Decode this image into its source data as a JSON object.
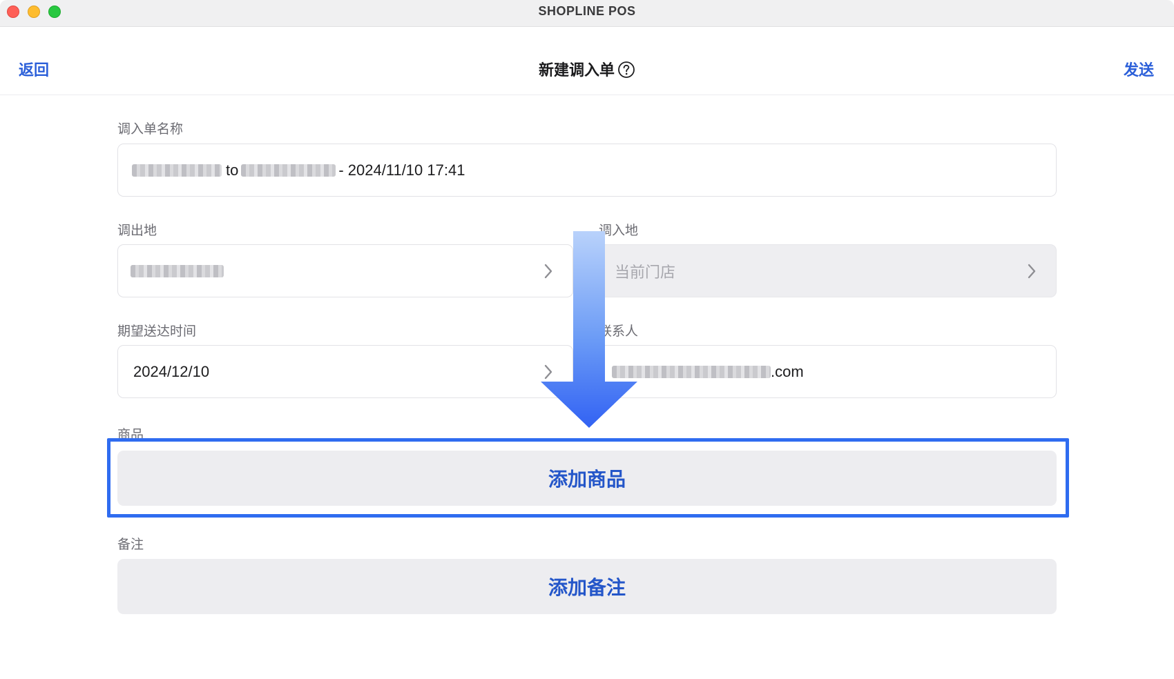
{
  "window": {
    "app_title": "SHOPLINE POS"
  },
  "header": {
    "back_label": "返回",
    "title": "新建调入单",
    "send_label": "发送"
  },
  "form": {
    "name": {
      "label": "调入单名称",
      "connector": "to",
      "suffix": "- 2024/11/10 17:41"
    },
    "from_location": {
      "label": "调出地"
    },
    "to_location": {
      "label": "调入地",
      "placeholder": "当前门店"
    },
    "expected_date": {
      "label": "期望送达时间",
      "value": "2024/12/10"
    },
    "contact": {
      "label": "联系人",
      "value_suffix": ".com"
    },
    "products": {
      "label": "商品",
      "add_button": "添加商品"
    },
    "notes": {
      "label": "备注",
      "add_button": "添加备注"
    }
  },
  "colors": {
    "accent": "#2b5fd9",
    "highlight": "#2f6cf0"
  },
  "icons": [
    "help-icon",
    "chevron-right-icon",
    "down-arrow-icon"
  ]
}
